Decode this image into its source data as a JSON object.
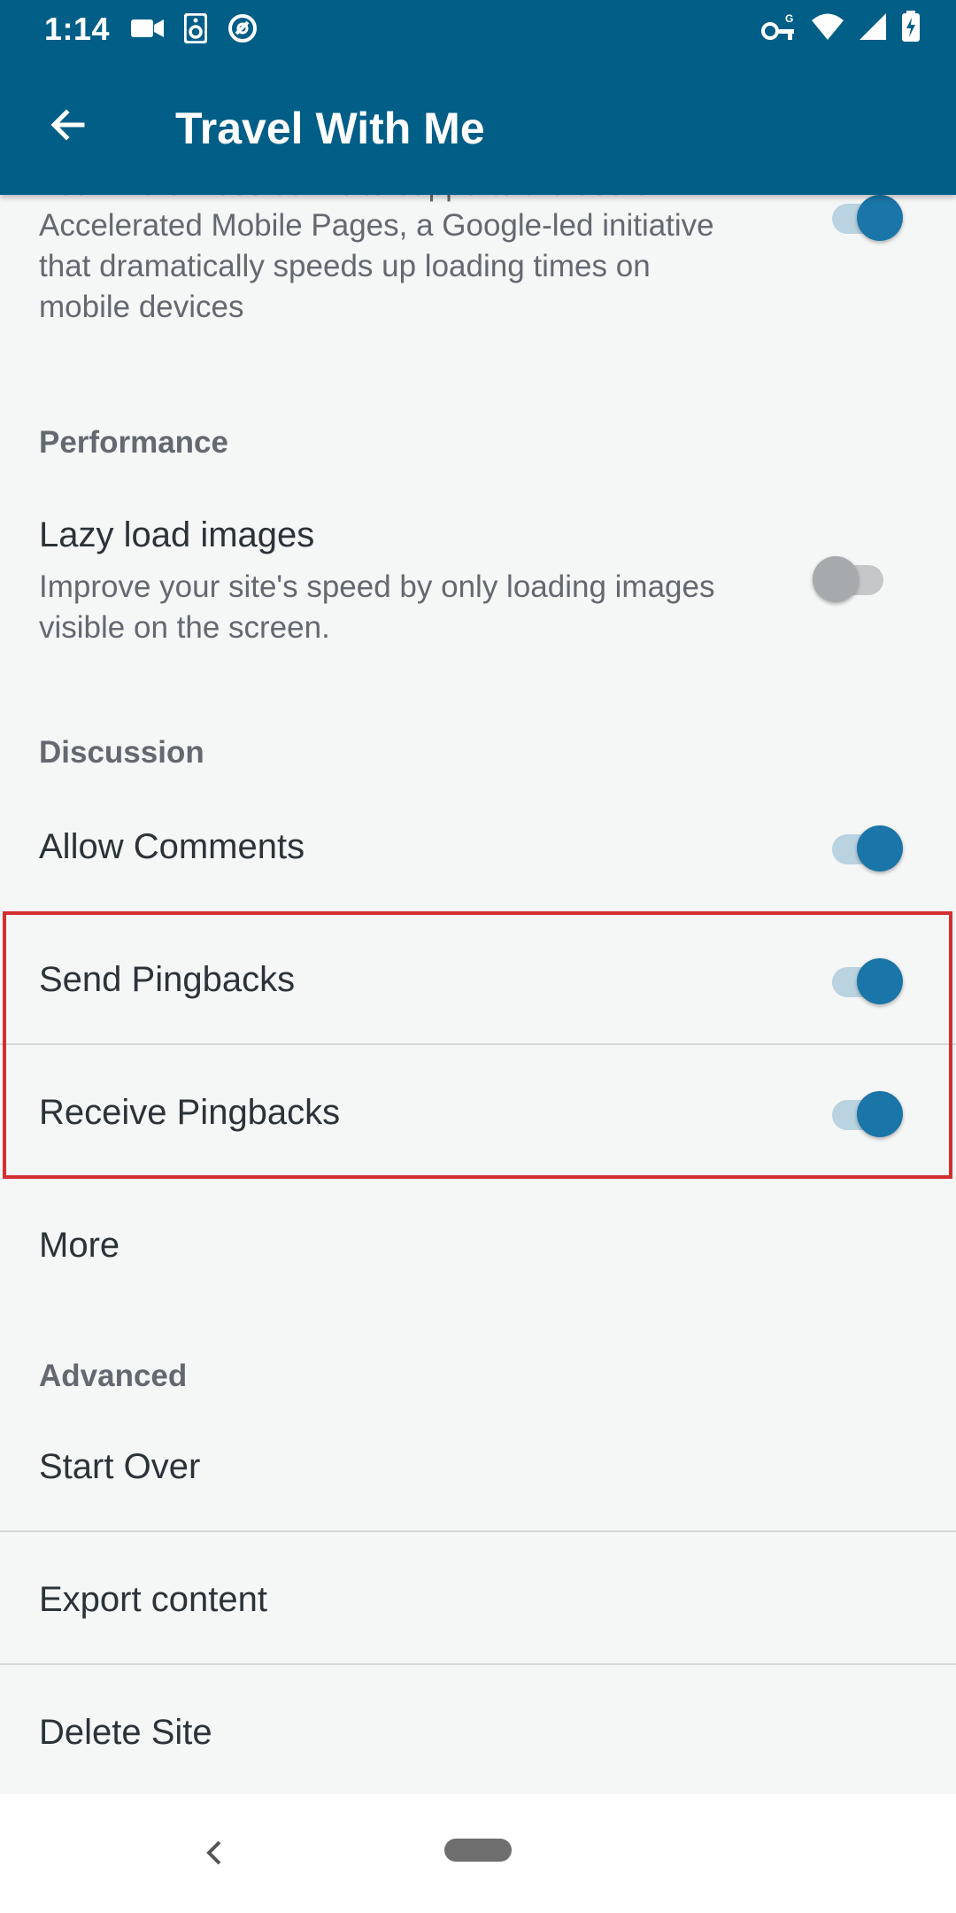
{
  "status_bar": {
    "time": "1:14",
    "icons_left": [
      "video-icon",
      "speaker-icon",
      "sync-icon"
    ],
    "icons_right": [
      "vpn-key-icon",
      "wifi-icon",
      "signal-icon",
      "battery-icon"
    ]
  },
  "app_bar": {
    "title": "Travel With Me",
    "back_icon": "arrow-back-icon"
  },
  "settings": {
    "amp_description": "Your WordPress.com site supports the use of Accelerated Mobile Pages, a Google-led initiative that dramatically speeds up loading times on mobile devices",
    "amp_enabled": true,
    "performance_header": "Performance",
    "lazy_load": {
      "title": "Lazy load images",
      "subtitle": "Improve your site's speed by only loading images visible on the screen.",
      "enabled": false
    },
    "discussion_header": "Discussion",
    "allow_comments": {
      "title": "Allow Comments",
      "enabled": true
    },
    "send_pingbacks": {
      "title": "Send Pingbacks",
      "enabled": true
    },
    "receive_pingbacks": {
      "title": "Receive Pingbacks",
      "enabled": true
    },
    "more": "More",
    "advanced_header": "Advanced",
    "start_over": "Start Over",
    "export_content": "Export content",
    "delete_site": "Delete Site"
  },
  "colors": {
    "app_bar": "#005e87",
    "toggle_on": "#1a75a8",
    "highlight": "#d32f2f"
  },
  "nav_bar": {
    "back_icon": "nav-back-icon",
    "home_icon": "nav-home-pill-icon"
  }
}
